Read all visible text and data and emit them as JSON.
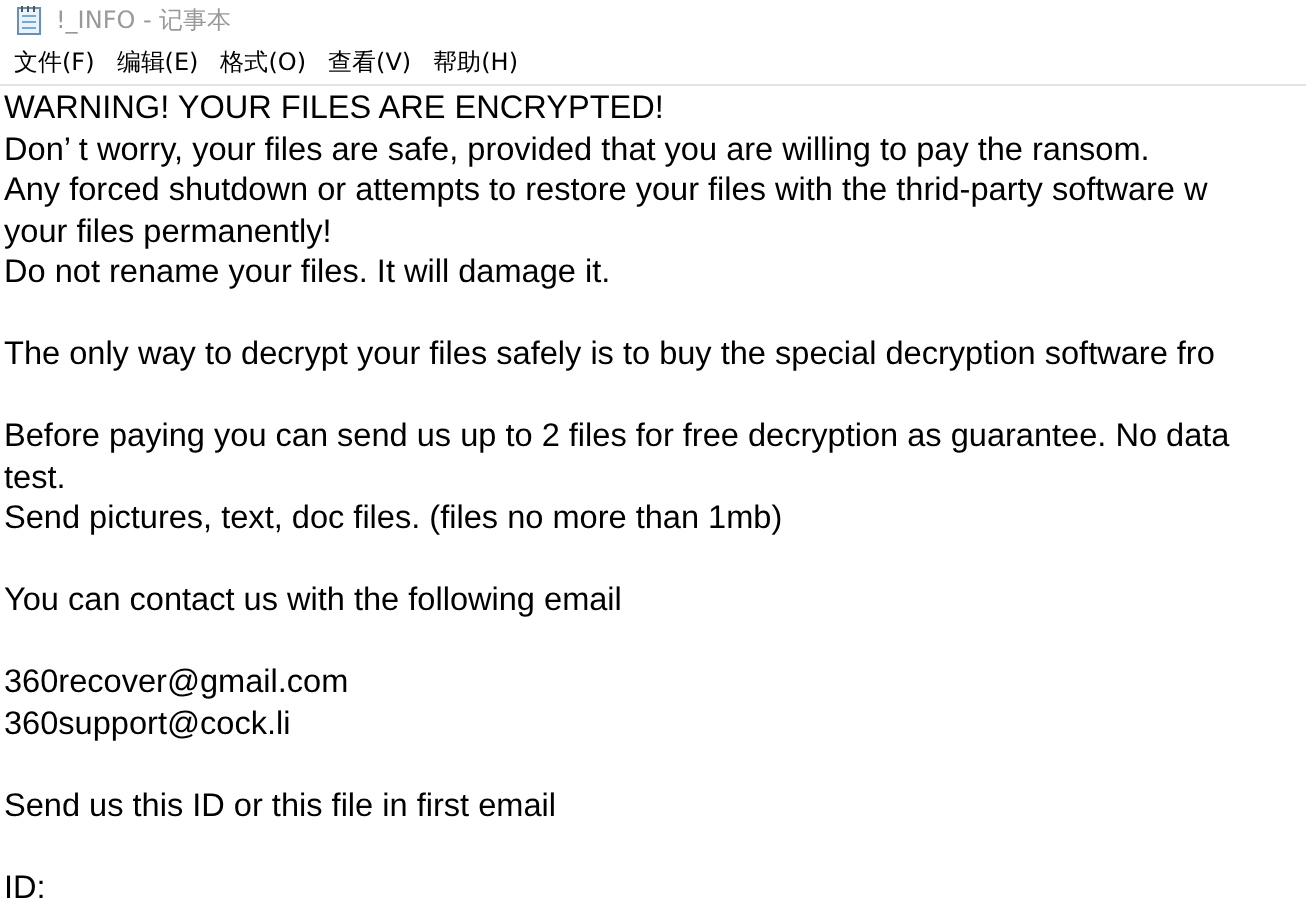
{
  "window": {
    "title": "!_INFO - 记事本"
  },
  "menu": [
    "文件(F)",
    "编辑(E)",
    "格式(O)",
    "查看(V)",
    "帮助(H)"
  ],
  "paragraphs": [
    [
      "WARNING! YOUR FILES ARE ENCRYPTED!",
      "Don’ t worry, your files are safe, provided that you are willing to pay the ransom.",
      "Any forced shutdown or attempts to restore your files with the thrid-party software w",
      "your files permanently!",
      "Do not rename your files. It will damage it."
    ],
    [
      "The only way to decrypt your files safely is to buy the special decryption software fro"
    ],
    [
      "Before paying you can send us up to 2 files for free decryption as guarantee. No data",
      "test.",
      "Send pictures, text, doc files. (files no more than 1mb)"
    ],
    [
      "You can contact us with the following email"
    ],
    [
      "360recover@gmail.com",
      "360support@cock.li"
    ],
    [
      "Send us this ID or this file in first email"
    ],
    [
      "ID:"
    ]
  ]
}
